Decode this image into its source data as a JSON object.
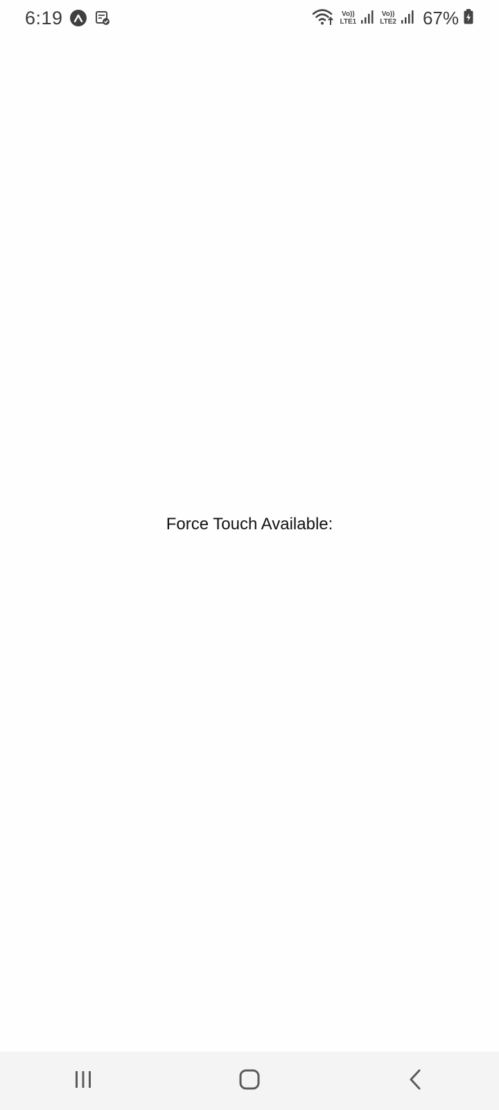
{
  "status_bar": {
    "time": "6:19",
    "left_icons": [
      "app-notification-icon",
      "task-check-icon"
    ],
    "sim1_top": "Vo))",
    "sim1_bottom": "LTE1",
    "sim2_top": "Vo))",
    "sim2_bottom": "LTE2",
    "battery": "67%",
    "battery_charging": true,
    "text_color": "#3a3a3a"
  },
  "main": {
    "label": "Force Touch Available:"
  },
  "nav_bar": {
    "background": "#f4f4f4",
    "buttons": [
      "recents-icon",
      "home-icon",
      "back-icon"
    ]
  }
}
